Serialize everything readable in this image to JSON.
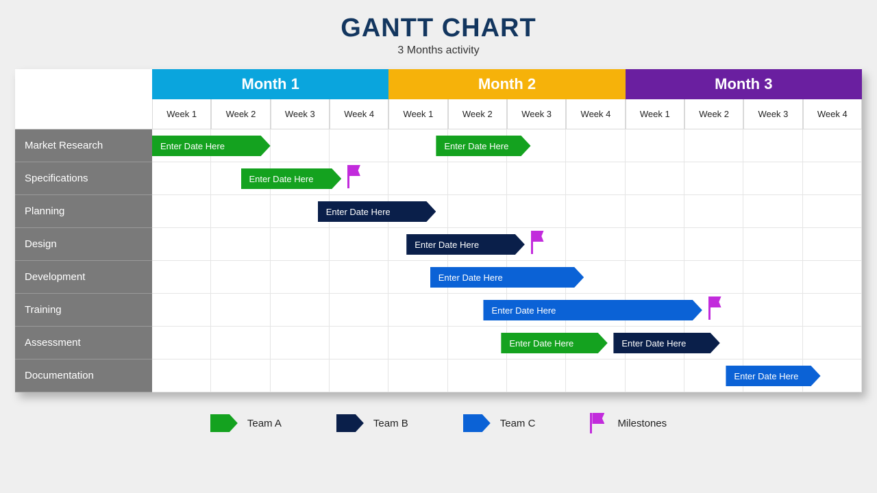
{
  "title": "GANTT CHART",
  "subtitle": "3 Months activity",
  "months": [
    "Month 1",
    "Month 2",
    "Month 3"
  ],
  "weeks": [
    "Week 1",
    "Week 2",
    "Week 3",
    "Week 4",
    "Week 1",
    "Week 2",
    "Week 3",
    "Week 4",
    "Week 1",
    "Week 2",
    "Week 3",
    "Week 4"
  ],
  "tasks": [
    "Market Research",
    "Specifications",
    "Planning",
    "Design",
    "Development",
    "Training",
    "Assessment",
    "Documentation"
  ],
  "bar_label": "Enter Date Here",
  "colors": {
    "teamA": "#14a21f",
    "teamB": "#0a1f4a",
    "teamC": "#0b62d6",
    "milestone": "#c22bdc",
    "month1": "#0aa5dd",
    "month2": "#f6b20a",
    "month3": "#6a1fa0"
  },
  "legend": [
    {
      "key": "teamA",
      "label": "Team A"
    },
    {
      "key": "teamB",
      "label": "Team B"
    },
    {
      "key": "teamC",
      "label": "Team C"
    },
    {
      "key": "milestone",
      "label": "Milestones"
    }
  ],
  "chart_data": {
    "type": "bar",
    "time_unit": "week",
    "total_weeks": 12,
    "tasks": [
      {
        "name": "Market Research",
        "bars": [
          {
            "team": "A",
            "start": 1,
            "span": 2
          },
          {
            "team": "A",
            "start": 5.8,
            "span": 1.6
          }
        ]
      },
      {
        "name": "Specifications",
        "bars": [
          {
            "team": "A",
            "start": 2.5,
            "span": 1.7
          }
        ],
        "milestone_at": 4.3
      },
      {
        "name": "Planning",
        "bars": [
          {
            "team": "B",
            "start": 3.8,
            "span": 2
          }
        ]
      },
      {
        "name": "Design",
        "bars": [
          {
            "team": "B",
            "start": 5.3,
            "span": 2
          }
        ],
        "milestone_at": 7.4
      },
      {
        "name": "Development",
        "bars": [
          {
            "team": "C",
            "start": 5.7,
            "span": 2.6
          }
        ]
      },
      {
        "name": "Training",
        "bars": [
          {
            "team": "C",
            "start": 6.6,
            "span": 3.7
          }
        ],
        "milestone_at": 10.4
      },
      {
        "name": "Assessment",
        "bars": [
          {
            "team": "A",
            "start": 6.9,
            "span": 1.8
          },
          {
            "team": "B",
            "start": 8.8,
            "span": 1.8
          }
        ]
      },
      {
        "name": "Documentation",
        "bars": [
          {
            "team": "C",
            "start": 10.7,
            "span": 1.6
          }
        ]
      }
    ]
  }
}
